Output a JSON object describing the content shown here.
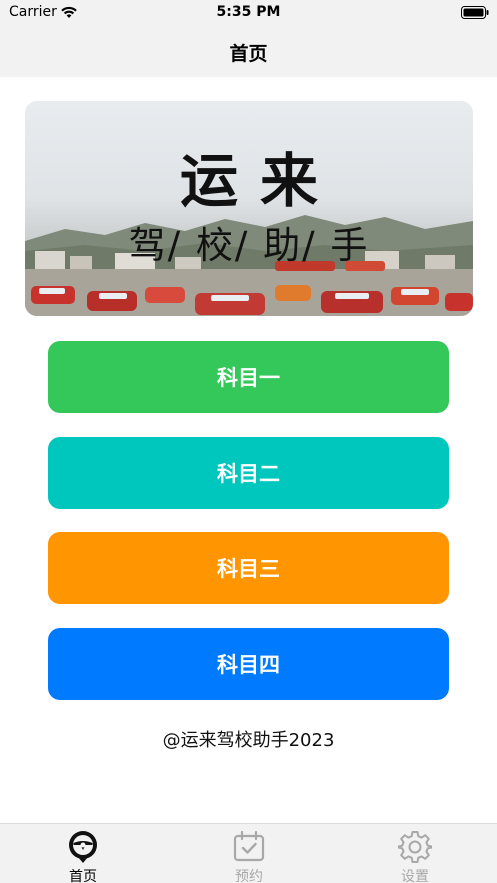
{
  "status_bar": {
    "carrier": "Carrier",
    "time": "5:35 PM",
    "wifi_icon": "wifi-icon",
    "battery_icon": "battery-icon"
  },
  "nav": {
    "title": "首页"
  },
  "banner": {
    "title": "运来",
    "subtitle": "驾/ 校/ 助/ 手"
  },
  "subjects": [
    {
      "label": "科目一",
      "color": "#34c759"
    },
    {
      "label": "科目二",
      "color": "#00c7be"
    },
    {
      "label": "科目三",
      "color": "#ff9500"
    },
    {
      "label": "科目四",
      "color": "#007aff"
    }
  ],
  "footer": {
    "copyright": "@运来驾校助手2023"
  },
  "tab_bar": {
    "tabs": [
      {
        "label": "首页",
        "icon": "steering-wheel-icon",
        "active": true
      },
      {
        "label": "预约",
        "icon": "calendar-check-icon",
        "active": false
      },
      {
        "label": "设置",
        "icon": "gear-icon",
        "active": false
      }
    ]
  }
}
